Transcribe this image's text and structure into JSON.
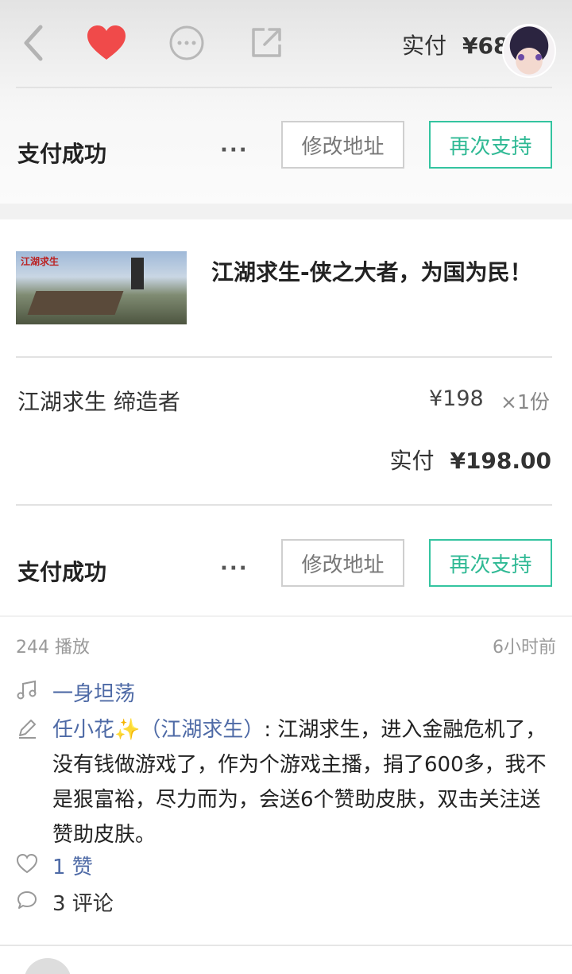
{
  "header": {
    "paid_label": "实付",
    "paid_amount": "¥68"
  },
  "order_top": {
    "status": "支付成功",
    "more": "···",
    "modify_address": "修改地址",
    "support_again": "再次支持"
  },
  "order": {
    "project_title": "江湖求生-侠之大者，为国为民！",
    "thumbnail_logo": "江湖求生",
    "reward_name": "江湖求生 缔造者",
    "reward_price": "¥198",
    "reward_qty": "×1份",
    "paid_label": "实付",
    "paid_amount": "¥198.00",
    "status": "支付成功",
    "more": "···",
    "modify_address": "修改地址",
    "support_again": "再次支持"
  },
  "feed": {
    "plays": "244 播放",
    "time": "6小时前",
    "music": "一身坦荡",
    "author": "任小花",
    "sparkle": "✨",
    "author_tag": "（江湖求生）",
    "post_text": ": 江湖求生，进入金融危机了，没有钱做游戏了，作为个游戏主播，捐了600多，我不是狠富裕，尽力而为，会送6个赞助皮肤，双击关注送赞助皮肤。",
    "likes": "1 赞",
    "comments": "3 评论"
  },
  "colors": {
    "accent_green": "#2fb994",
    "like_red": "#f04a4a",
    "link_blue": "#4e6aa6"
  }
}
